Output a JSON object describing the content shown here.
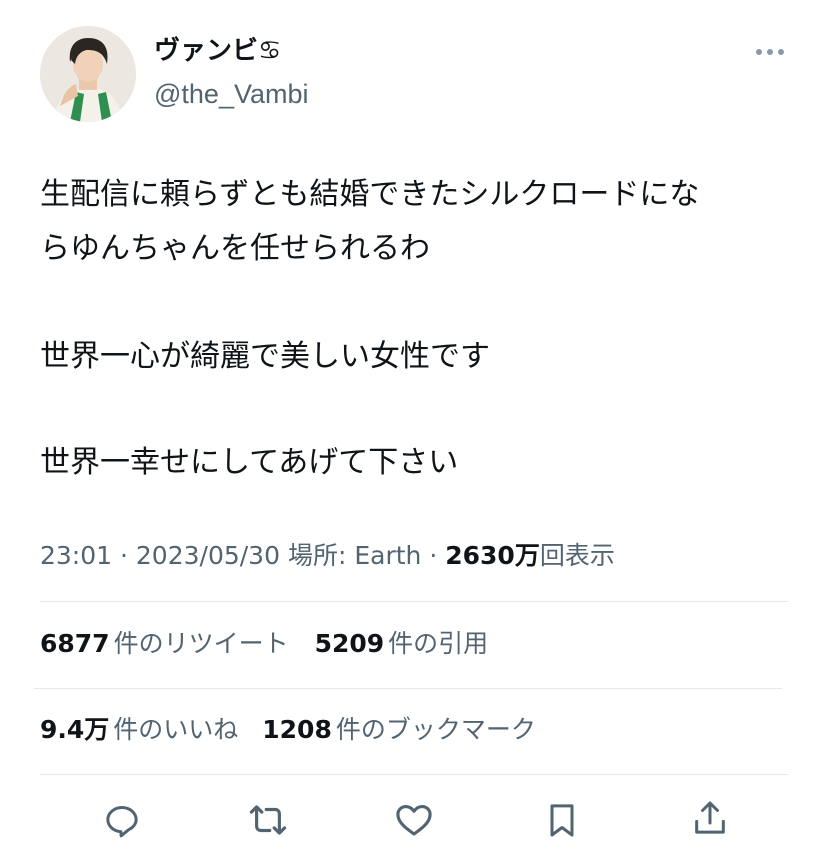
{
  "author": {
    "display_name": "ヴァンビ♋",
    "handle": "@the_Vambi"
  },
  "tweet": {
    "lines": [
      "生配信に頼らずとも結婚できたシルクロードにな",
      "らゆんちゃんを任せられるわ",
      "世界一心が綺麗で美しい女性です",
      "世界一幸せにしてあげて下さい"
    ]
  },
  "meta": {
    "time": "23:01",
    "date": "2023/05/30",
    "location": "場所: Earth",
    "separator": "·",
    "views_count": "2630万",
    "views_label": "回表示"
  },
  "stats": {
    "retweets": {
      "count": "6877",
      "label": "件のリツイート"
    },
    "quotes": {
      "count": "5209",
      "label": "件の引用"
    },
    "likes": {
      "count": "9.4万",
      "label": "件のいいね"
    },
    "bookmarks": {
      "count": "1208",
      "label": "件のブックマーク"
    }
  },
  "icons": {
    "more": "more-horizontal-icon",
    "reply": "reply-icon",
    "retweet": "retweet-icon",
    "like": "heart-icon",
    "bookmark": "bookmark-icon",
    "share": "share-icon"
  },
  "colors": {
    "text_primary": "#0f1419",
    "text_secondary": "#536471",
    "divider": "#e6e9eb"
  }
}
